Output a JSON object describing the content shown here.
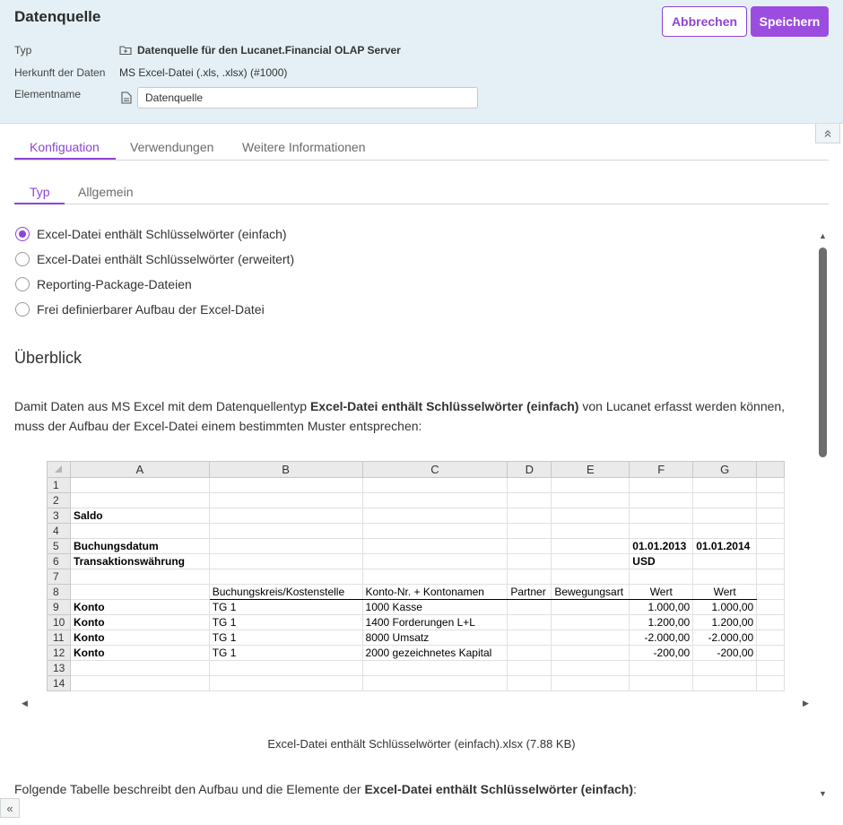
{
  "header": {
    "title": "Datenquelle",
    "cancel_label": "Abbrechen",
    "save_label": "Speichern",
    "type_label": "Typ",
    "type_value": "Datenquelle für den Lucanet.Financial OLAP Server",
    "origin_label": "Herkunft der Daten",
    "origin_value": "MS Excel-Datei (.xls, .xlsx) (#1000)",
    "element_label": "Elementname",
    "element_value": "Datenquelle"
  },
  "tabs": [
    "Konfiguation",
    "Verwendungen",
    "Weitere Informationen"
  ],
  "subtabs": [
    "Typ",
    "Allgemein"
  ],
  "radio_options": [
    "Excel-Datei enthält Schlüsselwörter (einfach)",
    "Excel-Datei enthält Schlüsselwörter (erweitert)",
    "Reporting-Package-Dateien",
    "Frei definierbarer Aufbau der Excel-Datei"
  ],
  "selected_option": 0,
  "overview": {
    "title": "Überblick",
    "para_prefix": "Damit Daten aus MS Excel mit dem Datenquellentyp ",
    "para_bold": "Excel-Datei enthält Schlüsselwörter (einfach)",
    "para_suffix": " von Lucanet erfasst werden können, muss der Aufbau der Excel-Datei einem bestimmten Muster entsprechen:"
  },
  "sheet": {
    "columns": [
      "A",
      "B",
      "C",
      "D",
      "E",
      "F",
      "G"
    ],
    "rows": [
      [
        "1",
        "",
        "",
        "",
        "",
        "",
        "",
        ""
      ],
      [
        "2",
        "",
        "",
        "",
        "",
        "",
        "",
        ""
      ],
      [
        "3",
        "Saldo",
        "",
        "",
        "",
        "",
        "",
        ""
      ],
      [
        "4",
        "",
        "",
        "",
        "",
        "",
        "",
        ""
      ],
      [
        "5",
        "Buchungsdatum",
        "",
        "",
        "",
        "",
        "01.01.2013",
        "01.01.2014"
      ],
      [
        "6",
        "Transaktionswährung",
        "",
        "",
        "",
        "",
        "USD",
        ""
      ],
      [
        "7",
        "",
        "",
        "",
        "",
        "",
        "",
        ""
      ],
      [
        "8",
        "",
        "Buchungskreis/Kostenstelle",
        "Konto-Nr. + Kontonamen",
        "Partner",
        "Bewegungsart",
        "Wert",
        "Wert"
      ],
      [
        "9",
        "Konto",
        "TG 1",
        "1000 Kasse",
        "",
        "",
        "1.000,00",
        "1.000,00"
      ],
      [
        "10",
        "Konto",
        "TG 1",
        "1400 Forderungen L+L",
        "",
        "",
        "1.200,00",
        "1.200,00"
      ],
      [
        "11",
        "Konto",
        "TG 1",
        "8000 Umsatz",
        "",
        "",
        "-2.000,00",
        "-2.000,00"
      ],
      [
        "12",
        "Konto",
        "TG 1",
        "2000 gezeichnetes Kapital",
        "",
        "",
        "-200,00",
        "-200,00"
      ],
      [
        "13",
        "",
        "",
        "",
        "",
        "",
        "",
        ""
      ],
      [
        "14",
        "",
        "",
        "",
        "",
        "",
        "",
        ""
      ]
    ]
  },
  "caption": "Excel-Datei enthält Schlüsselwörter (einfach).xlsx (7.88 KB)",
  "footer_para": {
    "prefix": "Folgende Tabelle beschreibt den Aufbau und die Elemente der ",
    "bold": "Excel-Datei enthält Schlüsselwörter (einfach)",
    "suffix": ":"
  },
  "icons": {
    "collapse": "double-chevron-up-icon",
    "expand": "double-chevron-left-icon"
  },
  "colors": {
    "accent": "#8e44d8",
    "header_bg": "#e4f0f6"
  }
}
